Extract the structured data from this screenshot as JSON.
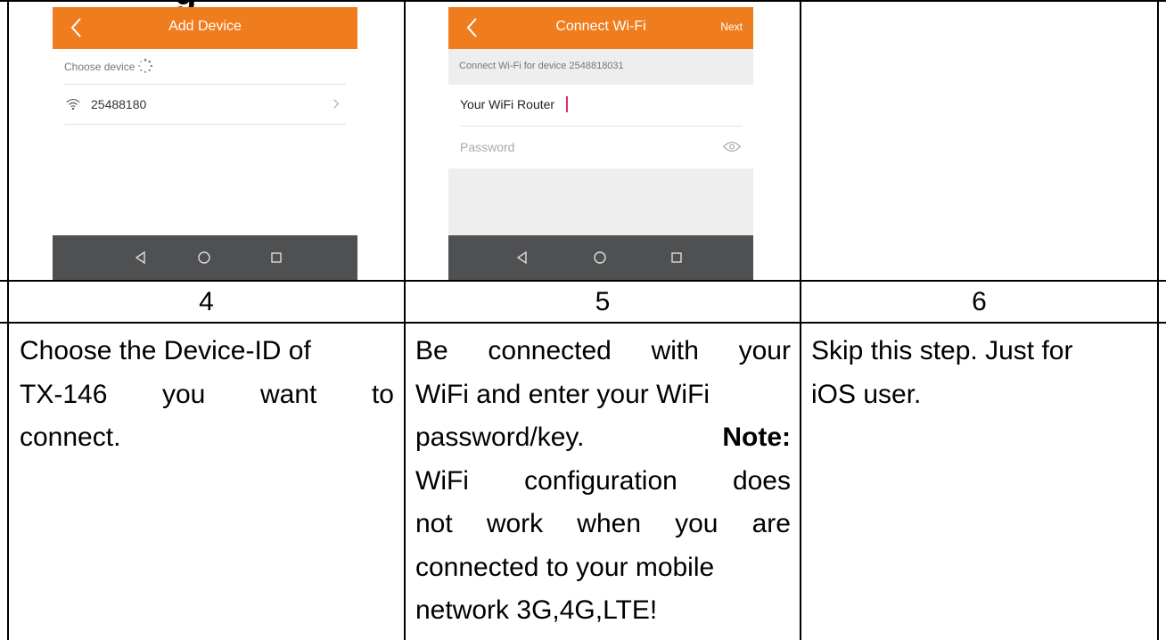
{
  "heading_fragment": "g",
  "screens": [
    {
      "title": "Add Device",
      "section_label": "Choose device",
      "device_id": "25488180"
    },
    {
      "title": "Connect Wi-Fi",
      "next_label": "Next",
      "subtitle": "Connect Wi-Fi for device 2548818031",
      "ssid_value": "Your WiFi Router",
      "password_placeholder": "Password"
    }
  ],
  "steps": [
    {
      "number": "4",
      "lines": [
        "Choose the Device-ID of",
        [
          "TX-146",
          "you",
          "want",
          "to"
        ],
        "connect."
      ]
    },
    {
      "number": "5",
      "lines": [
        [
          "Be",
          "connected",
          "with",
          "your"
        ],
        "WiFi and enter your WiFi",
        "password/key.",
        "Note:",
        [
          "WiFi",
          "configuration",
          "does"
        ],
        [
          "not",
          "work",
          "when",
          "you",
          "are"
        ],
        "connected to your mobile",
        "network 3G,4G,LTE!"
      ]
    },
    {
      "number": "6",
      "lines": [
        "Skip this step. Just for",
        "iOS user."
      ]
    }
  ],
  "colors": {
    "accent": "#ef7d1e",
    "navbar": "#4f5052"
  }
}
